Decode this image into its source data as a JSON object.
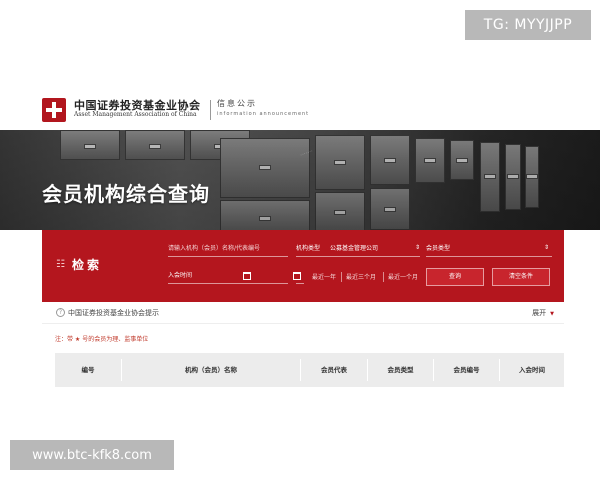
{
  "overlay": {
    "tg_badge": "TG: MYYJJPP",
    "site_badge": "www.btc-kfk8.com"
  },
  "header": {
    "org_name_cn": "中国证券投资基金业协会",
    "org_name_en": "Asset Management Association of China",
    "section_cn": "信息公示",
    "section_en": "information announcement"
  },
  "banner": {
    "title": "会员机构综合查询"
  },
  "search": {
    "title": "检索",
    "name_placeholder": "请输入机构（会员）名称/代表编号",
    "org_type_label": "机构类型",
    "org_type_value": "公募基金管理公司",
    "member_type_label": "会员类型",
    "join_time_label": "入会时间",
    "range_options": [
      "最近一年",
      "最近三个月",
      "最近一个月"
    ],
    "query_button": "查询",
    "clear_button": "清空条件"
  },
  "hint": {
    "text": "中国证券投资基金业协会提示",
    "expand_label": "展开"
  },
  "note": {
    "text": "注：带 ★ 号的会员为理、监事单位"
  },
  "table": {
    "columns": [
      "编号",
      "机构（会员）名称",
      "会员代表",
      "会员类型",
      "会员编号",
      "入会时间"
    ]
  },
  "colors": {
    "brand_red": "#b4161e",
    "note_red": "#c0392b",
    "table_header_bg": "#ececec"
  }
}
